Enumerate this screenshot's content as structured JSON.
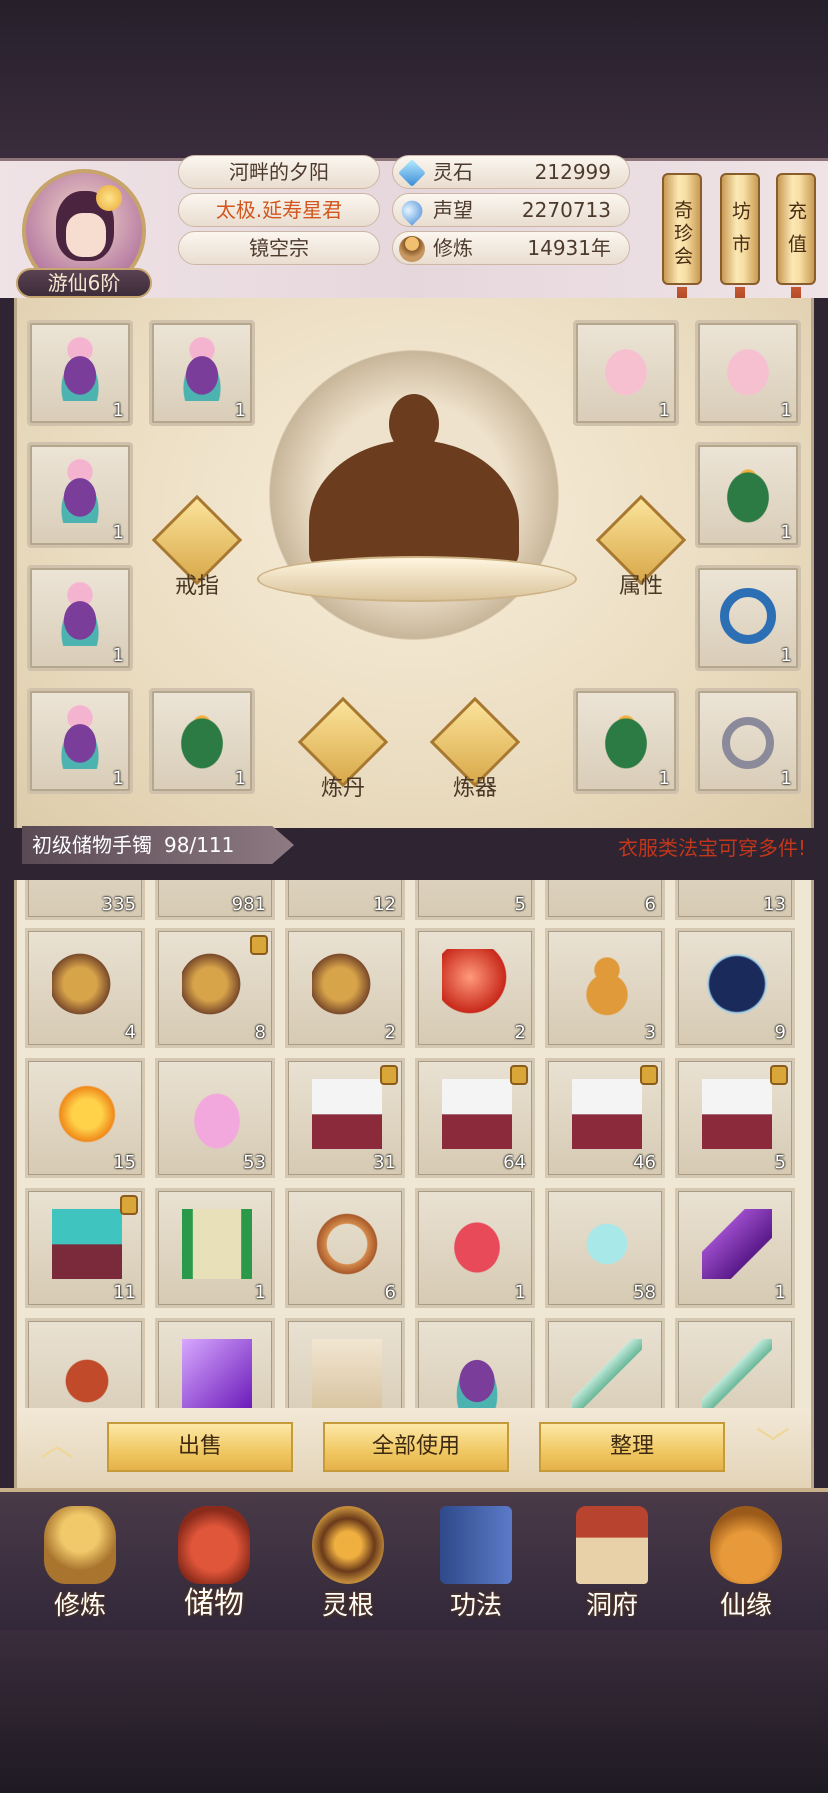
{
  "player": {
    "rank": "游仙6阶",
    "name": "河畔的夕阳",
    "title": "太极.延寿星君",
    "sect": "镜空宗"
  },
  "stats": [
    {
      "label": "灵石",
      "value": "212999",
      "icon": "spirit-stone-icon"
    },
    {
      "label": "声望",
      "value": "2270713",
      "icon": "prestige-icon"
    },
    {
      "label": "修炼",
      "value": "14931年",
      "icon": "cultivation-icon"
    }
  ],
  "top_buttons": [
    "奇珍会",
    "坊市",
    "充值"
  ],
  "equipment": {
    "left_slots": [
      {
        "count": "1",
        "icon": "purple-robe-icon"
      },
      {
        "count": "1",
        "icon": "purple-robe-icon"
      },
      {
        "count": "1",
        "icon": "purple-robe-icon"
      },
      {
        "count": "1",
        "icon": "purple-robe-icon"
      },
      {
        "count": "1",
        "icon": "purple-robe-icon"
      },
      {
        "count": "1",
        "icon": "green-robe-icon"
      }
    ],
    "right_slots": [
      {
        "count": "1",
        "icon": "pink-robe-icon"
      },
      {
        "count": "1",
        "icon": "pink-robe-icon"
      },
      {
        "count": "1",
        "icon": "green-robe-icon"
      },
      {
        "count": "1",
        "icon": "blue-ring-icon"
      },
      {
        "count": "1",
        "icon": "green-robe-icon"
      },
      {
        "count": "1",
        "icon": "silver-ring-icon"
      }
    ],
    "actions": {
      "ring": "戒指",
      "attributes": "属性",
      "alchemy": "炼丹",
      "forge": "炼器"
    }
  },
  "bag": {
    "name": "初级储物手镯",
    "capacity": "98/111",
    "notice": "衣服类法宝可穿多件!",
    "partial_row": [
      "335",
      "981",
      "12",
      "5",
      "6",
      "13"
    ],
    "rows": [
      [
        {
          "count": "4",
          "icon": "scroll-bundle-icon",
          "locked": false
        },
        {
          "count": "8",
          "icon": "scroll-bundle-icon",
          "locked": true
        },
        {
          "count": "2",
          "icon": "scroll-bundle-icon",
          "locked": false
        },
        {
          "count": "2",
          "icon": "red-orb-icon",
          "locked": false
        },
        {
          "count": "3",
          "icon": "gourd-icon",
          "locked": false
        },
        {
          "count": "9",
          "icon": "star-disc-icon",
          "locked": false
        }
      ],
      [
        {
          "count": "15",
          "icon": "amber-gem-icon",
          "locked": false
        },
        {
          "count": "53",
          "icon": "lotus-icon",
          "locked": false
        },
        {
          "count": "31",
          "icon": "rice-box-icon",
          "locked": true
        },
        {
          "count": "64",
          "icon": "rice-box-icon",
          "locked": true
        },
        {
          "count": "46",
          "icon": "rice-box-icon",
          "locked": true
        },
        {
          "count": "5",
          "icon": "rice-box-icon",
          "locked": true
        }
      ],
      [
        {
          "count": "11",
          "icon": "jade-box-icon",
          "locked": true
        },
        {
          "count": "1",
          "icon": "green-scroll-icon",
          "locked": false
        },
        {
          "count": "6",
          "icon": "bracelet-icon",
          "locked": false
        },
        {
          "count": "1",
          "icon": "red-lotus-icon",
          "locked": false
        },
        {
          "count": "58",
          "icon": "cloud-charm-icon",
          "locked": false
        },
        {
          "count": "1",
          "icon": "purple-crystal-icon",
          "locked": false
        }
      ],
      [
        {
          "count": "",
          "icon": "teapot-icon",
          "locked": false
        },
        {
          "count": "",
          "icon": "purple-gem-icon",
          "locked": false
        },
        {
          "count": "",
          "icon": "paper-scroll-icon",
          "locked": false
        },
        {
          "count": "",
          "icon": "purple-robe-icon",
          "locked": false
        },
        {
          "count": "",
          "icon": "jade-sword-icon",
          "locked": false
        },
        {
          "count": "",
          "icon": "jade-sword-icon",
          "locked": false
        }
      ]
    ]
  },
  "toolbar": {
    "sell": "出售",
    "use_all": "全部使用",
    "sort": "整理"
  },
  "nav": [
    {
      "label": "修炼",
      "icon": "cultivation-monk-icon"
    },
    {
      "label": "储物",
      "icon": "storage-bag-icon"
    },
    {
      "label": "灵根",
      "icon": "spirit-root-icon"
    },
    {
      "label": "功法",
      "icon": "technique-book-icon"
    },
    {
      "label": "洞府",
      "icon": "cave-house-icon"
    },
    {
      "label": "仙缘",
      "icon": "fate-gourd-icon"
    }
  ],
  "colors": {
    "accent_gold": "#f0c862",
    "title_orange": "#d2571e",
    "notice_red": "#c2361a"
  }
}
